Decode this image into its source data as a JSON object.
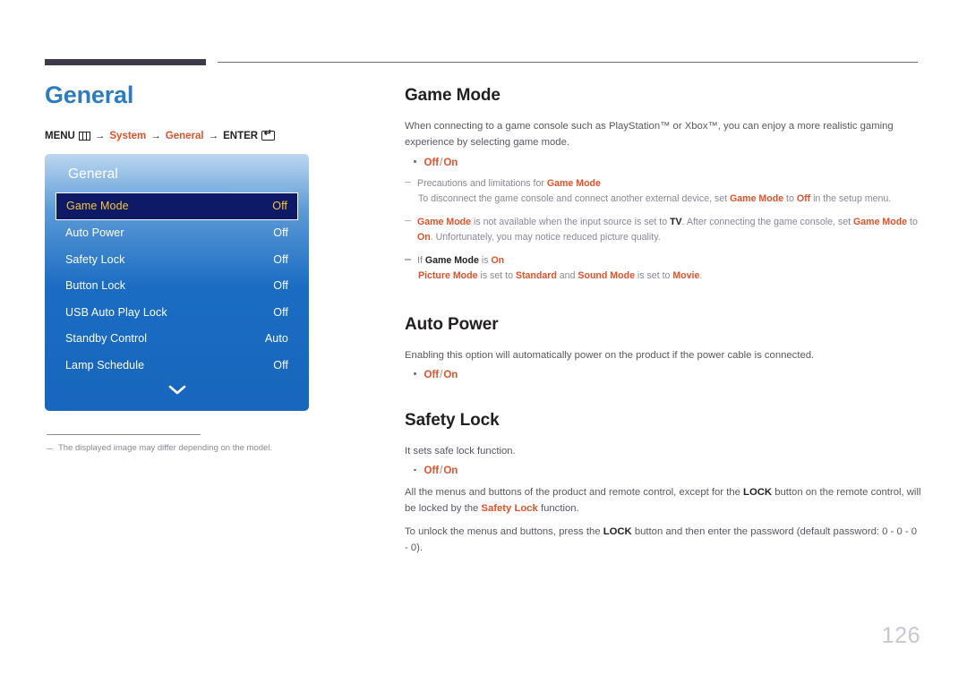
{
  "page": {
    "title": "General",
    "number": "126"
  },
  "breadcrumb": {
    "menu_label": "MENU",
    "menu_icon": "menu-grid-icon",
    "arrow": "→",
    "step1": "System",
    "step2": "General",
    "enter_label": "ENTER",
    "enter_icon": "enter-key-icon"
  },
  "osd": {
    "title": "General",
    "chevron_icon": "chevron-down-icon",
    "rows": [
      {
        "label": "Game Mode",
        "value": "Off",
        "selected": true
      },
      {
        "label": "Auto Power",
        "value": "Off",
        "selected": false
      },
      {
        "label": "Safety Lock",
        "value": "Off",
        "selected": false
      },
      {
        "label": "Button Lock",
        "value": "Off",
        "selected": false
      },
      {
        "label": "USB Auto Play Lock",
        "value": "Off",
        "selected": false
      },
      {
        "label": "Standby Control",
        "value": "Auto",
        "selected": false
      },
      {
        "label": "Lamp Schedule",
        "value": "Off",
        "selected": false
      }
    ]
  },
  "footnote": {
    "text": "The displayed image may differ depending on the model."
  },
  "sections": {
    "game_mode": {
      "title": "Game Mode",
      "intro_1": "When connecting to a game console such as PlayStation™ or Xbox™, you can enjoy a more realistic gaming experience by",
      "intro_2": "selecting game mode.",
      "option_off": "Off",
      "option_sep": "/",
      "option_on": "On",
      "note1_pre": "Precautions and limitations for ",
      "note1_term": "Game Mode",
      "note1_sub_a": "To disconnect the game console and connect another external device, set ",
      "note1_sub_b": "Game Mode",
      "note1_sub_c": " to ",
      "note1_sub_d": "Off",
      "note1_sub_e": " in the setup menu.",
      "note2_a": "Game Mode",
      "note2_b": " is not available when the input source is set to ",
      "note2_c": "TV",
      "note2_d": ". After connecting the game console, set ",
      "note2_e": "Game Mode",
      "note2_f": " to",
      "note2_g": "On",
      "note2_h": ". Unfortunately, you may notice reduced picture quality.",
      "note3_a": "If ",
      "note3_b": "Game Mode",
      "note3_c": " is ",
      "note3_d": "On",
      "note3_sub_a": "Picture Mode",
      "note3_sub_b": " is set to ",
      "note3_sub_c": "Standard",
      "note3_sub_d": " and ",
      "note3_sub_e": "Sound Mode",
      "note3_sub_f": " is set to ",
      "note3_sub_g": "Movie",
      "note3_sub_h": "."
    },
    "auto_power": {
      "title": "Auto Power",
      "intro": "Enabling this option will automatically power on the product if the power cable is connected.",
      "option_off": "Off",
      "option_sep": "/",
      "option_on": "On"
    },
    "safety_lock": {
      "title": "Safety Lock",
      "intro": "It sets safe lock function.",
      "option_off": "Off",
      "option_sep": "/",
      "option_on": "On",
      "p1_a": "All the menus and buttons of the product and remote control, except for the ",
      "p1_b": "LOCK",
      "p1_c": " button on the remote control, will be locked by the ",
      "p1_d": "Safety Lock",
      "p1_e": " function.",
      "p2_a": "To unlock the menus and buttons, press the ",
      "p2_b": "LOCK",
      "p2_c": " button and then enter the password (default password: 0 - 0 - 0 - 0)."
    }
  }
}
